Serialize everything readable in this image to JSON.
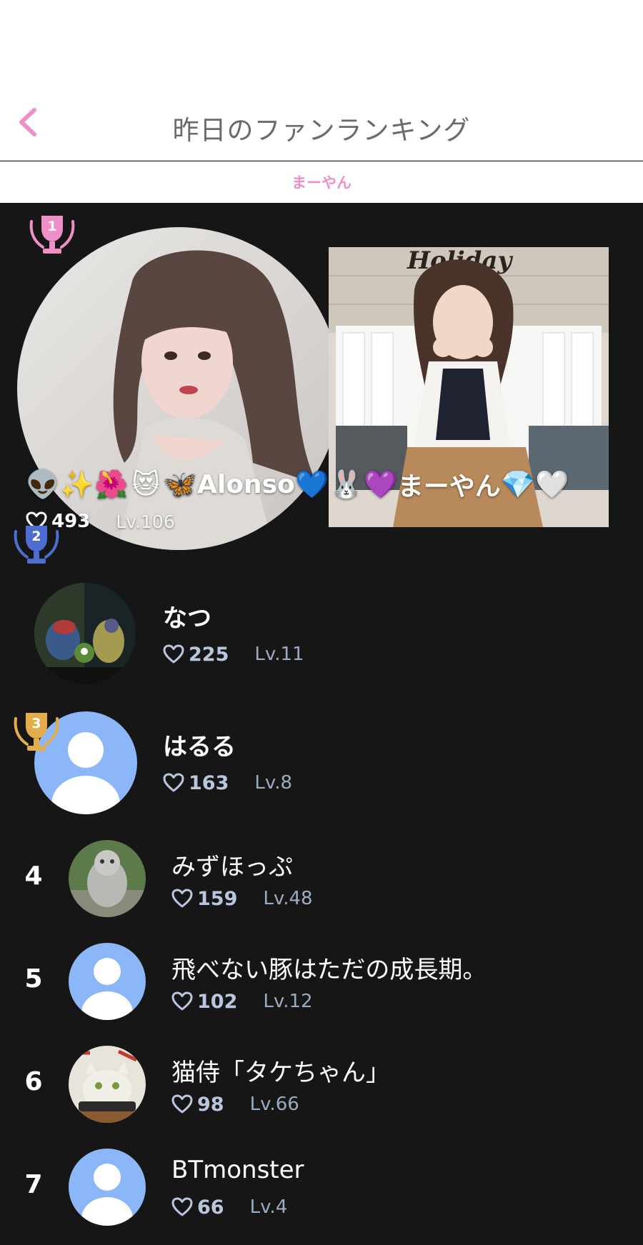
{
  "header": {
    "title": "昨日のファンランキング",
    "subtitle": "まーやん"
  },
  "top_fan": {
    "rank": "1",
    "name_emojis_before": [
      "👽",
      "✨",
      "🌺",
      "😻",
      "🦋"
    ],
    "name_text": "Alonso",
    "name_emojis_after": [
      "💙",
      "🐰",
      "💜"
    ],
    "host_overlay_text": "まーやん",
    "host_overlay_emojis": [
      "💎",
      "🤍"
    ],
    "hearts": "493",
    "level": "Lv.106",
    "host_photo_sign": "Holiday"
  },
  "ranks": [
    {
      "rank": "2",
      "name": "なつ",
      "hearts": "225",
      "level": "Lv.11"
    },
    {
      "rank": "3",
      "name": "はるる",
      "hearts": "163",
      "level": "Lv.8"
    },
    {
      "rank": "4",
      "name": "みずほっぷ",
      "hearts": "159",
      "level": "Lv.48"
    },
    {
      "rank": "5",
      "name": "飛べない豚はただの成長期。",
      "hearts": "102",
      "level": "Lv.12"
    },
    {
      "rank": "6",
      "name": "猫侍「タケちゃん」",
      "hearts": "98",
      "level": "Lv.66"
    },
    {
      "rank": "7",
      "name": "BTmonster",
      "hearts": "66",
      "level": "Lv.4"
    }
  ],
  "colors": {
    "accent_pink": "#ee8fc8",
    "trophy_gold": "#e3ae4a",
    "trophy_silver_blue": "#4d6dd1",
    "trophy_pink": "#ee8fc8",
    "default_avatar": "#8bb6f7",
    "background": "#161616"
  }
}
